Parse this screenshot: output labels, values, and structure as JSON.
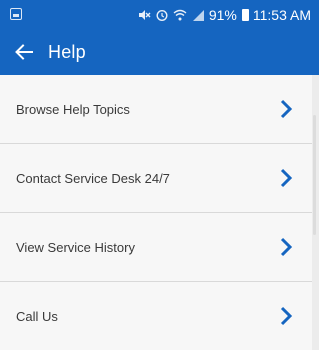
{
  "status_bar": {
    "battery_percent": "91%",
    "time": "11:53 AM",
    "icons": [
      "notification-icon",
      "mute-icon",
      "alarm-icon",
      "wifi-icon",
      "signal-icon",
      "battery-icon"
    ]
  },
  "app_bar": {
    "title": "Help",
    "back_icon": "back-arrow-icon"
  },
  "menu": {
    "items": [
      {
        "label": "Browse Help Topics"
      },
      {
        "label": "Contact Service Desk 24/7"
      },
      {
        "label": "View Service History"
      },
      {
        "label": "Call Us"
      }
    ],
    "chevron_icon": "chevron-right-icon"
  },
  "colors": {
    "primary": "#1565c0",
    "background": "#f7f7f7",
    "text": "#3a3a3a",
    "divider": "#d9d9d9"
  }
}
